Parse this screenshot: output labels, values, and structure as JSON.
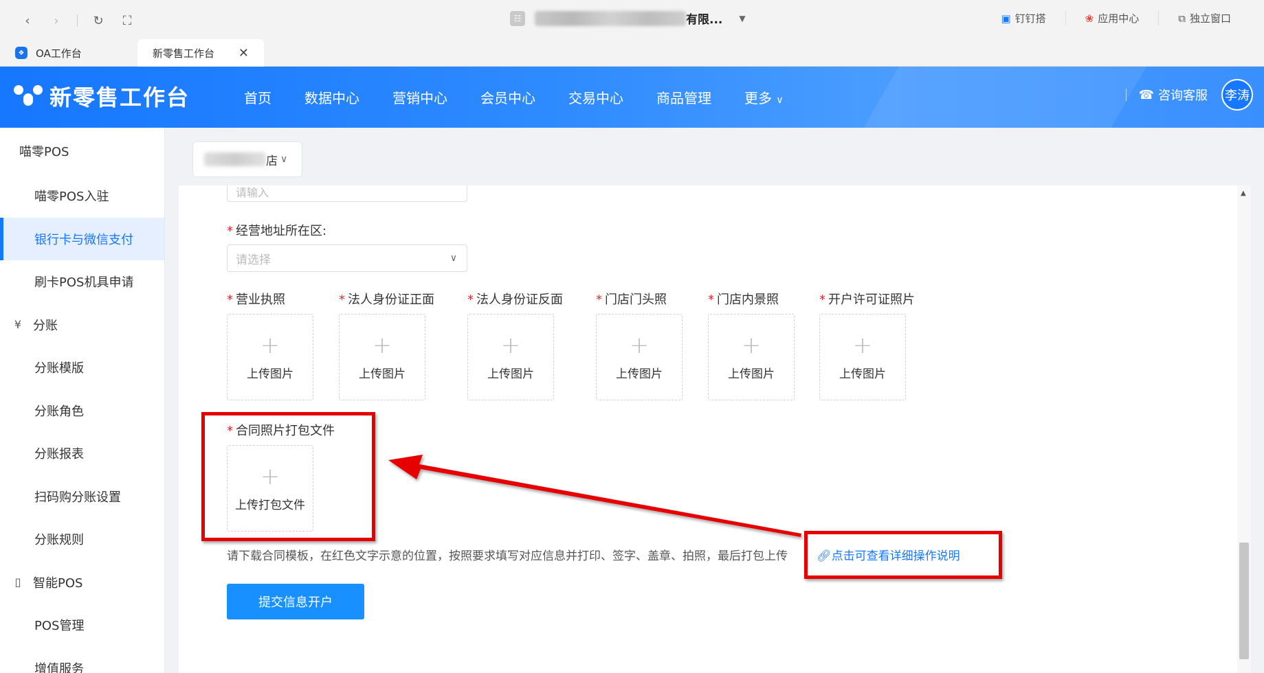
{
  "browser": {
    "org_name": "有限...",
    "right_items": [
      {
        "icon": "dingtalk-icon",
        "label": "钉钉搭"
      },
      {
        "icon": "app-center-icon",
        "label": "应用中心"
      },
      {
        "icon": "external-window-icon",
        "label": "独立窗口"
      }
    ],
    "tabs": [
      {
        "label": "OA工作台"
      },
      {
        "label": "新零售工作台"
      }
    ]
  },
  "header": {
    "brand": "新零售工作台",
    "menu": [
      "首页",
      "数据中心",
      "营销中心",
      "会员中心",
      "交易中心",
      "商品管理",
      "更多"
    ],
    "service": "咨询客服",
    "avatar": "李涛"
  },
  "sidebar": {
    "items": [
      {
        "label": "喵零POS",
        "level": 1
      },
      {
        "label": "喵零POS入驻",
        "level": 2
      },
      {
        "label": "银行卡与微信支付",
        "level": 2,
        "active": true
      },
      {
        "label": "刷卡POS机具申请",
        "level": 2
      },
      {
        "label": "分账",
        "level": 1,
        "icon": "yen-icon"
      },
      {
        "label": "分账模版",
        "level": 2
      },
      {
        "label": "分账角色",
        "level": 2
      },
      {
        "label": "分账报表",
        "level": 2
      },
      {
        "label": "扫码购分账设置",
        "level": 2
      },
      {
        "label": "分账规则",
        "level": 2
      },
      {
        "label": "智能POS",
        "level": 1,
        "icon": "device-icon"
      },
      {
        "label": "POS管理",
        "level": 2
      },
      {
        "label": "增值服务",
        "level": 2
      }
    ]
  },
  "store": {
    "suffix": "店"
  },
  "form": {
    "top_input_placeholder": "请输入",
    "address_label": "经营地址所在区:",
    "address_placeholder": "请选择",
    "uploads": [
      {
        "label": "营业执照",
        "button": "上传图片"
      },
      {
        "label": "法人身份证正面",
        "button": "上传图片"
      },
      {
        "label": "法人身份证反面",
        "button": "上传图片"
      },
      {
        "label": "门店门头照",
        "button": "上传图片"
      },
      {
        "label": "门店内景照",
        "button": "上传图片"
      },
      {
        "label": "开户许可证照片",
        "button": "上传图片"
      }
    ],
    "contract": {
      "label": "合同照片打包文件",
      "button": "上传打包文件"
    },
    "note": "请下载合同模板，在红色文字示意的位置，按照要求填写对应信息并打印、签字、盖章、拍照，最后打包上传",
    "help_link": "点击可查看详细操作说明",
    "submit": "提交信息开户"
  },
  "colors": {
    "primary": "#1677ff",
    "required": "#f5222d",
    "annotation": "#e60000"
  }
}
